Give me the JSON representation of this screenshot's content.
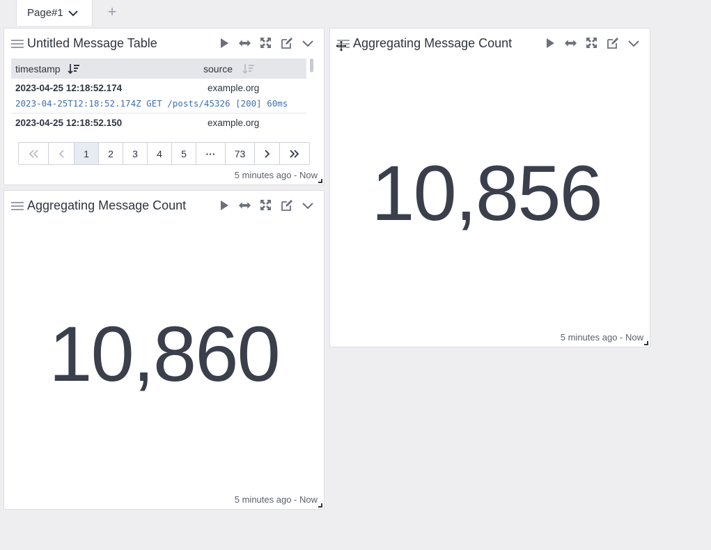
{
  "tabs": [
    {
      "label": "Page#1",
      "active": true
    }
  ],
  "add_tab_label": "+",
  "widgets": {
    "table": {
      "title": "Untitled Message Table",
      "columns": [
        "timestamp",
        "source"
      ],
      "rows": [
        {
          "timestamp": "2023-04-25 12:18:52.174",
          "source": "example.org",
          "message": "2023-04-25T12:18:52.174Z GET /posts/45326 [200] 60ms"
        },
        {
          "timestamp": "2023-04-25 12:18:52.150",
          "source": "example.org",
          "message": ""
        }
      ],
      "pagination": {
        "first": "«",
        "prev": "‹",
        "pages": [
          "1",
          "2",
          "3",
          "4",
          "5",
          "···",
          "73"
        ],
        "current": "1",
        "next": "›",
        "last": "»"
      },
      "footer": "5 minutes ago - Now"
    },
    "count_left": {
      "title": "Aggregating Message Count",
      "value": "10,860",
      "footer": "5 minutes ago - Now"
    },
    "count_right": {
      "title": "Aggregating Message Count",
      "value": "10,856",
      "footer": "5 minutes ago - Now"
    }
  },
  "icons": [
    "drag-handle-icon",
    "play-icon",
    "expand-horizontal-icon",
    "fullscreen-icon",
    "edit-icon",
    "chevron-down-icon",
    "sort-desc-icon",
    "move-cursor-icon"
  ],
  "colors": {
    "background": "#eeeef1",
    "panel": "#ffffff",
    "message_link": "#3d6fb3",
    "header_row": "#e5e6ea",
    "active_page": "#e7ebf2"
  }
}
